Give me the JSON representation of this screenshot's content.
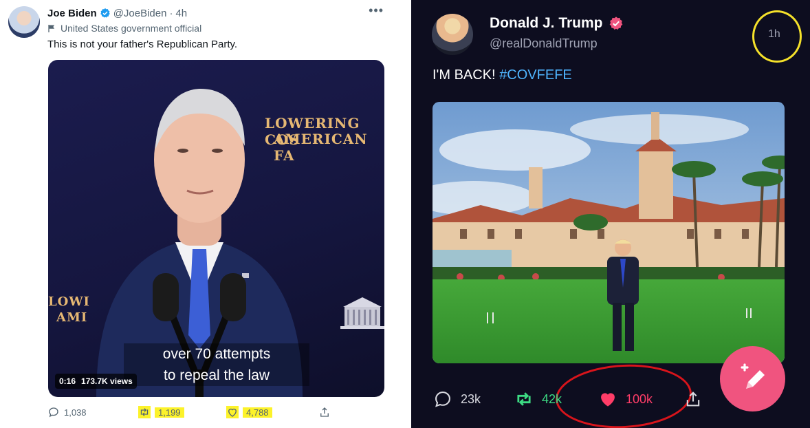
{
  "left_tweet": {
    "author_name": "Joe Biden",
    "handle": "@JoeBiden",
    "time": "4h",
    "label": "United States government official",
    "text": "This is not your father's Republican Party.",
    "stage_text": [
      "LOWERING COS",
      "AMERICAN FA",
      "LOWI",
      "AMI"
    ],
    "video": {
      "caption_line1": "over 70 attempts",
      "caption_line2": "to repeal the law",
      "duration": "0:16",
      "views": "173.7K views"
    },
    "stats": {
      "replies": "1,038",
      "retweets": "1,199",
      "likes": "4,788"
    },
    "highlight_color": "#fcf22a",
    "icons": [
      "verified-icon",
      "flag-icon",
      "more-icon",
      "reply-icon",
      "retweet-icon",
      "like-icon",
      "share-icon"
    ]
  },
  "right_tweet": {
    "author_name": "Donald J. Trump",
    "handle": "@realDonaldTrump",
    "time": "1h",
    "text": "I'M BACK!",
    "hashtag": "#COVFEFE",
    "stats": {
      "replies": "23k",
      "retweets": "42k",
      "likes": "100k"
    },
    "colors": {
      "background": "#0d0d1f",
      "hashtag": "#4fb5ff",
      "retweet": "#3ddc84",
      "like": "#ff3d68",
      "fab": "#f0547f",
      "time_ring": "#f5e12a",
      "like_oval": "#d8141b"
    },
    "icons": [
      "verified-badge-icon",
      "reply-icon",
      "retweet-icon",
      "heart-icon",
      "share-icon",
      "compose-pencil-icon"
    ]
  }
}
